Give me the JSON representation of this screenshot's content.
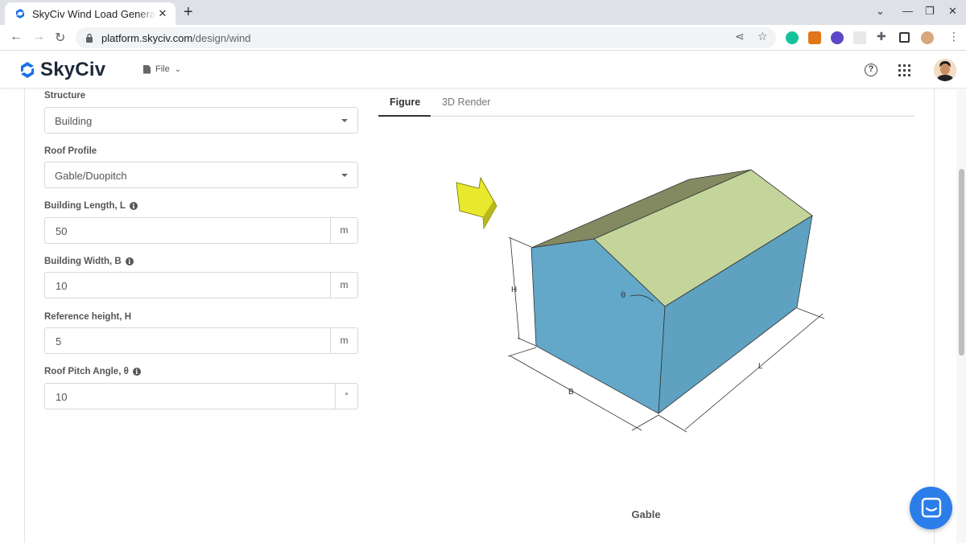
{
  "browser": {
    "tab_title": "SkyCiv Wind Load General",
    "tab_close": "✕",
    "new_tab": "+",
    "url_host": "platform.skyciv.com",
    "url_path": "/design/wind",
    "back": "←",
    "forward": "→",
    "reload": "↻",
    "minimize": "—",
    "restore": "❐",
    "close": "✕",
    "chevron": "⌄",
    "share": "⋖",
    "star": "☆",
    "menu": "⋮"
  },
  "app": {
    "brand": "SkyCiv",
    "file_menu": "File",
    "help": "?"
  },
  "form": {
    "structure": {
      "label": "Structure",
      "value": "Building"
    },
    "roof_profile": {
      "label": "Roof Profile",
      "value": "Gable/Duopitch"
    },
    "building_length": {
      "label": "Building Length, L",
      "value": "50",
      "unit": "m"
    },
    "building_width": {
      "label": "Building Width, B",
      "value": "10",
      "unit": "m"
    },
    "reference_height": {
      "label": "Reference height, H",
      "value": "5",
      "unit": "m"
    },
    "roof_pitch": {
      "label": "Roof Pitch Angle, θ",
      "value": "10",
      "unit": "°"
    }
  },
  "panel": {
    "tabs": [
      {
        "label": "Figure",
        "active": true
      },
      {
        "label": "3D Render",
        "active": false
      }
    ],
    "figure_labels": {
      "h": "H",
      "b": "B",
      "l": "L",
      "theta": "θ"
    },
    "caption": "Gable"
  },
  "colors": {
    "wall_front": "#63a8c8",
    "wall_side": "#5ea1c0",
    "roof_light": "#c3d59a",
    "roof_dark": "#838a61",
    "wind_arrow": "#e8e82c",
    "accent": "#2b7de9"
  }
}
